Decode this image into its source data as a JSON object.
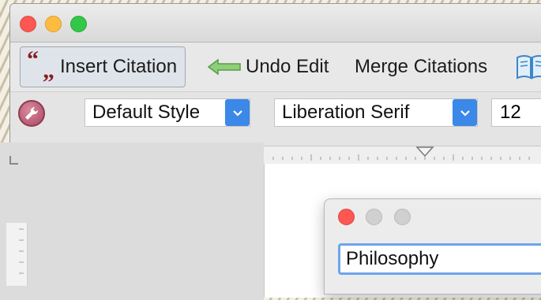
{
  "toolbar": {
    "insert_citation": "Insert Citation",
    "undo_edit": "Undo Edit",
    "merge_citations": "Merge Citations"
  },
  "format_bar": {
    "paragraph_style": "Default Style",
    "font_name": "Liberation Serif",
    "font_size": "12"
  },
  "dialog": {
    "search_value": "Philosophy"
  },
  "icons": {
    "insert_citation": "quote-icon",
    "undo_edit": "undo-arrow-icon",
    "bibliography": "book-icon",
    "settings": "wrench-icon"
  },
  "colors": {
    "accent": "#3b88e8",
    "quote": "#8a1d1d",
    "wrench": "#a94863"
  }
}
